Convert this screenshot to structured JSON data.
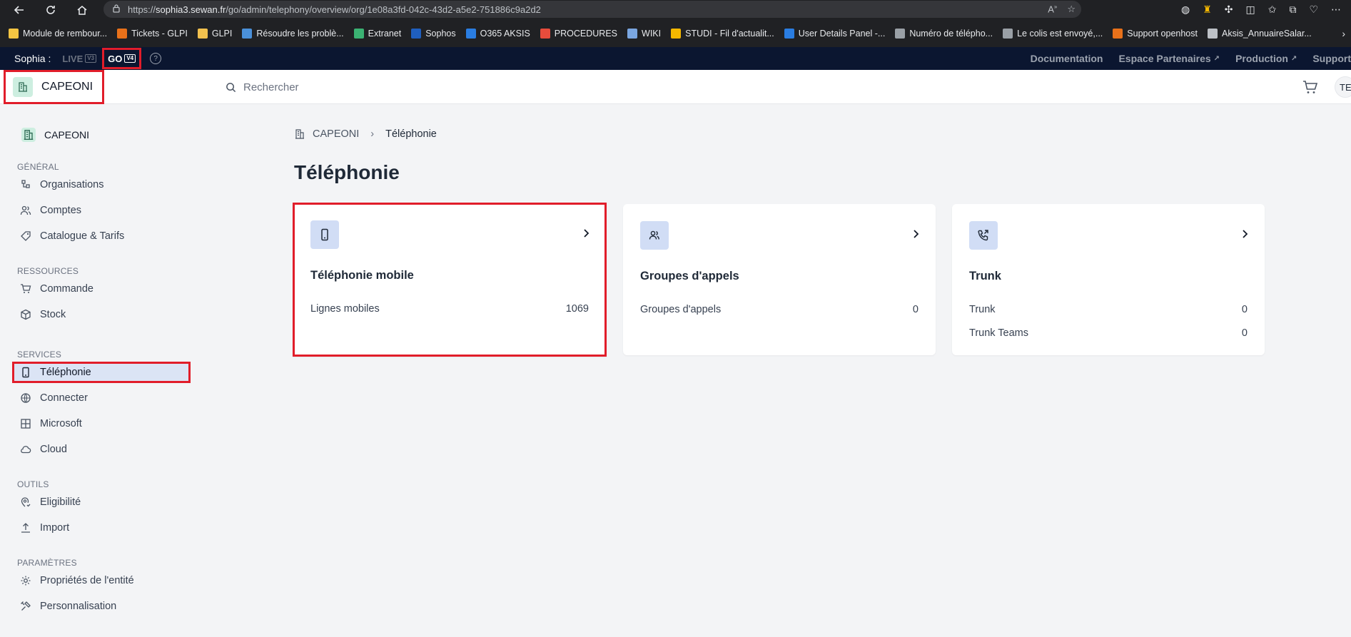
{
  "browser": {
    "url_prefix": "https://",
    "url_host": "sophia3.sewan.fr",
    "url_path": "/go/admin/telephony/overview/org/1e08a3fd-042c-43d2-a5e2-751886c9a2d2",
    "bookmarks": [
      {
        "label": "Module de rembour...",
        "color": "#f4c542"
      },
      {
        "label": "Tickets - GLPI",
        "color": "#e8711a"
      },
      {
        "label": "GLPI",
        "color": "#f2c14e"
      },
      {
        "label": "Résoudre les problè...",
        "color": "#4a90d9"
      },
      {
        "label": "Extranet",
        "color": "#3bb273"
      },
      {
        "label": "Sophos",
        "color": "#1f5fbf"
      },
      {
        "label": "O365 AKSIS",
        "color": "#2a7de1"
      },
      {
        "label": "PROCEDURES",
        "color": "#e74c3c"
      },
      {
        "label": "WIKI",
        "color": "#7aa6e0"
      },
      {
        "label": "STUDI - Fil d'actualit...",
        "color": "#f5b800"
      },
      {
        "label": "User Details Panel -...",
        "color": "#2a7de1"
      },
      {
        "label": "Numéro de télépho...",
        "color": "#9aa0a6"
      },
      {
        "label": "Le colis est envoyé,...",
        "color": "#9aa0a6"
      },
      {
        "label": "Support openhost",
        "color": "#e8711a"
      },
      {
        "label": "Aksis_AnnuaireSalar...",
        "color": "#bdc1c6"
      }
    ]
  },
  "strip": {
    "user": "Sophia :",
    "live_label": "LIVE",
    "live_version": "V3",
    "go_label": "GO",
    "go_version": "V4",
    "help": "?",
    "links": [
      "Documentation",
      "Espace Partenaires",
      "Production",
      "Support"
    ]
  },
  "header": {
    "org_name": "CAPEONI",
    "search_placeholder": "Rechercher",
    "avatar": "TE"
  },
  "sidebar": {
    "org_name": "CAPEONI",
    "sections": [
      {
        "title": "GÉNÉRAL",
        "items": [
          "Organisations",
          "Comptes",
          "Catalogue & Tarifs"
        ]
      },
      {
        "title": "RESSOURCES",
        "items": [
          "Commande",
          "Stock"
        ]
      },
      {
        "title": "SERVICES",
        "items": [
          "Téléphonie",
          "Connecter",
          "Microsoft",
          "Cloud"
        ]
      },
      {
        "title": "OUTILS",
        "items": [
          "Eligibilité",
          "Import"
        ]
      },
      {
        "title": "PARAMÈTRES",
        "items": [
          "Propriétés de l'entité",
          "Personnalisation"
        ]
      }
    ],
    "active": "Téléphonie"
  },
  "breadcrumb": {
    "root": "CAPEONI",
    "current": "Téléphonie"
  },
  "page": {
    "title": "Téléphonie"
  },
  "cards": [
    {
      "title": "Téléphonie mobile",
      "icon": "smartphone-icon",
      "rows": [
        {
          "label": "Lignes mobiles",
          "value": "1069"
        }
      ]
    },
    {
      "title": "Groupes d'appels",
      "icon": "users-icon",
      "rows": [
        {
          "label": "Groupes d'appels",
          "value": "0"
        }
      ]
    },
    {
      "title": "Trunk",
      "icon": "phone-forward-icon",
      "rows": [
        {
          "label": "Trunk",
          "value": "0"
        },
        {
          "label": "Trunk Teams",
          "value": "0"
        }
      ]
    }
  ],
  "colors": {
    "highlight": "#e11d2a",
    "active_bg": "#dbe4f5",
    "icon_bg": "#d1ddf5",
    "strip_bg": "#0b1630"
  }
}
